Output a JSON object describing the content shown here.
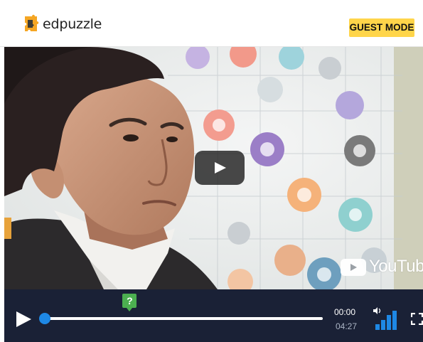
{
  "header": {
    "brand": "edpuzzle",
    "guest_mode_label": "GUEST MODE",
    "logo_icon": "puzzle-piece-icon",
    "brand_color": "#f5a623",
    "badge_color": "#ffd54a"
  },
  "video": {
    "watermark": "YouTube",
    "center_play_icon": "play-icon"
  },
  "player": {
    "question_marker_label": "?",
    "current_time": "00:00",
    "total_time": "04:27",
    "progress": 0,
    "question_marker_position": 0.3,
    "volume_icon": "volume-icon",
    "fullscreen_icon": "fullscreen-icon",
    "accent_color": "#1e88e5",
    "question_color": "#4caf50",
    "bar_color": "#1a2136"
  }
}
